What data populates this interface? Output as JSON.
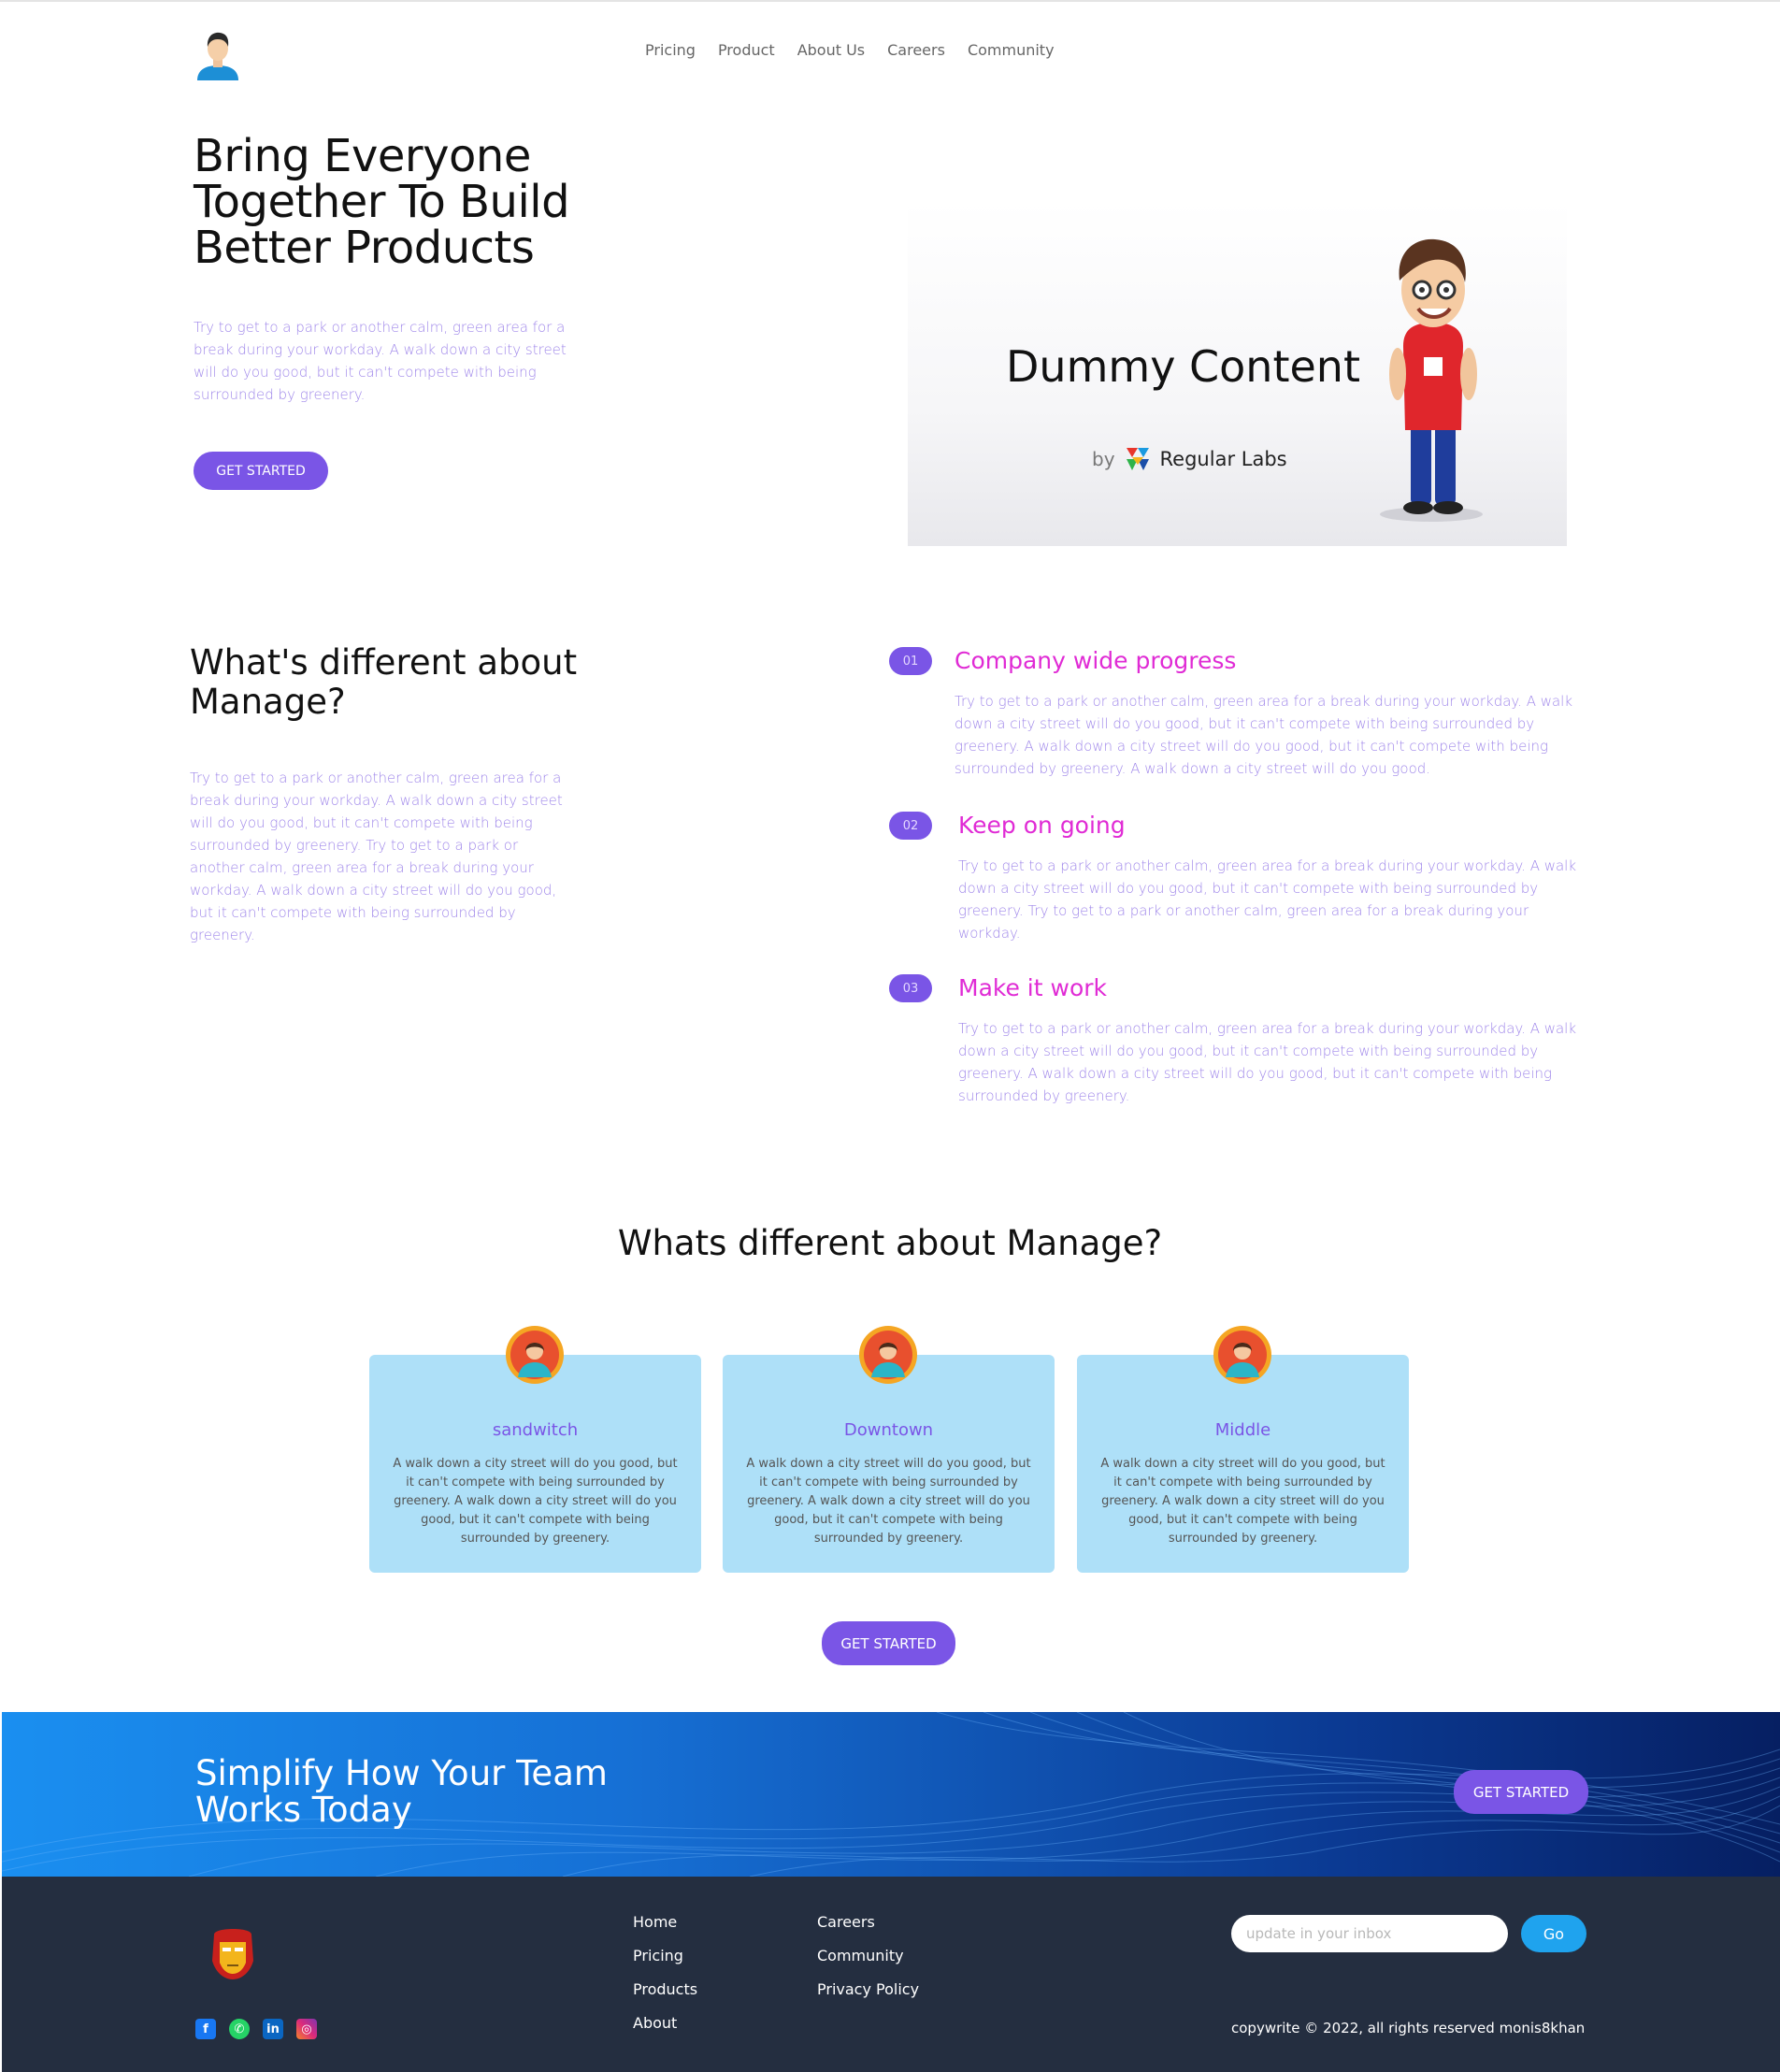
{
  "nav": {
    "items": [
      "Pricing",
      "Product",
      "About Us",
      "Careers",
      "Community"
    ]
  },
  "hero": {
    "title": "Bring Everyone Together To Build Better Products",
    "text": "Try to get to a park or another calm, green area for a break during your workday. A walk down a city street will do you good, but it can't compete with being surrounded by greenery.",
    "button": "GET STARTED",
    "image": {
      "title": "Dummy Content",
      "by": "by",
      "brand": "Regular Labs"
    }
  },
  "about": {
    "title": "What's different about Manage?",
    "text": "Try to get to a park or another calm, green area for a break during your workday. A walk down a city street will do you good, but it can't compete with being surrounded by greenery. Try to get to a park or another calm, green area for a break during your workday. A walk down a city street will do you good, but it can't compete with being surrounded by greenery.",
    "features": [
      {
        "number": "01",
        "title": "Company wide progress",
        "text": "Try to get to a park or another calm, green area for a break during your workday. A walk down a city street will do you good, but it can't compete with being surrounded by greenery. A walk down a city street will do you good, but it can't compete with being surrounded by greenery. A walk down a city street will do you good."
      },
      {
        "number": "02",
        "title": "Keep on going",
        "text": "Try to get to a park or another calm, green area for a break during your workday. A walk down a city street will do you good, but it can't compete with being surrounded by greenery. Try to get to a park or another calm, green area for a break during your workday."
      },
      {
        "number": "03",
        "title": "Make it work",
        "text": "Try to get to a park or another calm, green area for a break during your workday. A walk down a city street will do you good, but it can't compete with being surrounded by greenery. A walk down a city street will do you good, but it can't compete with being surrounded by greenery."
      }
    ]
  },
  "testimonials": {
    "title": "Whats different about Manage?",
    "cards": [
      {
        "name": "sandwitch",
        "text": "A walk down a city street will do you good, but it can't compete with being surrounded by greenery. A walk down a city street will do you good, but it can't compete with being surrounded by greenery."
      },
      {
        "name": "Downtown",
        "text": "A walk down a city street will do you good, but it can't compete with being surrounded by greenery. A walk down a city street will do you good, but it can't compete with being surrounded by greenery."
      },
      {
        "name": "Middle",
        "text": "A walk down a city street will do you good, but it can't compete with being surrounded by greenery. A walk down a city street will do you good, but it can't compete with being surrounded by greenery."
      }
    ],
    "button": "GET STARTED"
  },
  "banner": {
    "title": "Simplify How Your Team Works Today",
    "button": "GET STARTED"
  },
  "footer": {
    "links_col1": [
      "Home",
      "Pricing",
      "Products",
      "About"
    ],
    "links_col2": [
      "Careers",
      "Community",
      "Privacy Policy"
    ],
    "newsletter_placeholder": "update in your inbox",
    "go_button": "Go",
    "copyright": "copywrite © 2022, all rights reserved monis8khan",
    "socials": [
      "facebook-icon",
      "whatsapp-icon",
      "linkedin-icon",
      "instagram-icon"
    ]
  },
  "colors": {
    "accent": "#7a55e6",
    "feature_title": "#e02bd5",
    "card_bg": "#aee0f8",
    "footer_bg": "#242e40",
    "go_button": "#1fa3ee"
  }
}
